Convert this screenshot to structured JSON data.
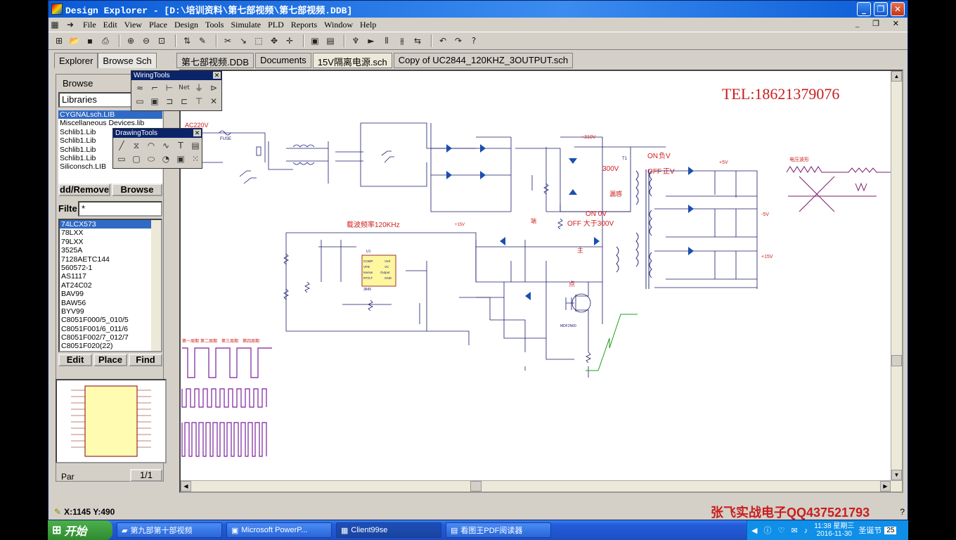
{
  "window": {
    "title": "Design Explorer - [D:\\培训资料\\第七部视频\\第七部视频.DDB]"
  },
  "menu": [
    "File",
    "Edit",
    "View",
    "Place",
    "Design",
    "Tools",
    "Simulate",
    "PLD",
    "Reports",
    "Window",
    "Help"
  ],
  "left": {
    "tabs": [
      "Explorer",
      "Browse Sch"
    ],
    "browse_label": "Browse",
    "libraries_combo": "Libraries",
    "libraries": [
      "CYGNALsch.LIB",
      "Miscellaneous Devices.lib",
      "Schlib1.Lib",
      "Schlib1.Lib",
      "Schlib1.Lib",
      "Schlib1.Lib",
      "Siliconsch.LIB"
    ],
    "add_remove_button": "dd/Remove",
    "browse_button": "Browse",
    "filter_label": "Filte",
    "filter_value": "*",
    "components": [
      "74LCX573",
      "78LXX",
      "79LXX",
      "3525A",
      "7128AETC144",
      "560572-1",
      "AS1117",
      "AT24C02",
      "BAV99",
      "BAW56",
      "BYV99",
      "C8051F000/5_010/5",
      "C8051F001/6_011/6",
      "C8051F002/7_012/7",
      "C8051F020(22)"
    ],
    "edit_button": "Edit",
    "place_button": "Place",
    "find_button": "Find",
    "part_label": "Par",
    "part_page": "1/1"
  },
  "palettes": {
    "wiring_title": "WiringTools",
    "drawing_title": "DrawingTools"
  },
  "doc_tabs": [
    "第七部视频.DDB",
    "Documents",
    "15V隔离电源.sch",
    "Copy of UC2844_120KHZ_3OUTPUT.sch"
  ],
  "schematic": {
    "tel": "TEL:18621379076",
    "freq_note": "载波频率120KHz",
    "ic_label": "U1",
    "ic_part": "3845",
    "ic_pins_left": [
      "COMP",
      "VFB",
      "Isense",
      "RT/CT"
    ],
    "ic_pins_right": [
      "Vref",
      "VC",
      "Output",
      "GND"
    ],
    "mosfet_label": "MDF2N60",
    "transformer_label": "T1",
    "ac_label": "AC220V",
    "fuse_label": "FUSE",
    "on_label": "ON",
    "off_label": "OFF",
    "volt_300": "300V",
    "ann_neg_v": "负V",
    "ann_pos_v": "正V",
    "ann_on_0v": "ON   0V",
    "ann_off_300v": "OFF  大于300V",
    "ann_leakage": "漏感",
    "ann_main": "主",
    "ann_point": "点",
    "ann_ao": "端",
    "ann_vs_wave": "电压波形",
    "wave_labels": [
      "第一周期",
      "第二周期",
      "第三周期",
      "第四周期"
    ],
    "rails": [
      "+5V",
      "-5V",
      "+15V"
    ]
  },
  "status": {
    "coords": "X:1145 Y:490",
    "watermark": "张飞实战电子QQ437521793"
  },
  "taskbar": {
    "start": "开始",
    "tasks": [
      "第九部第十部视频",
      "Microsoft PowerP...",
      "Client99se",
      "看图王PDF阅读器"
    ],
    "time": "11:38 星期三",
    "date": "2016-11-30",
    "ime": "圣诞节",
    "ime_num": "25"
  }
}
